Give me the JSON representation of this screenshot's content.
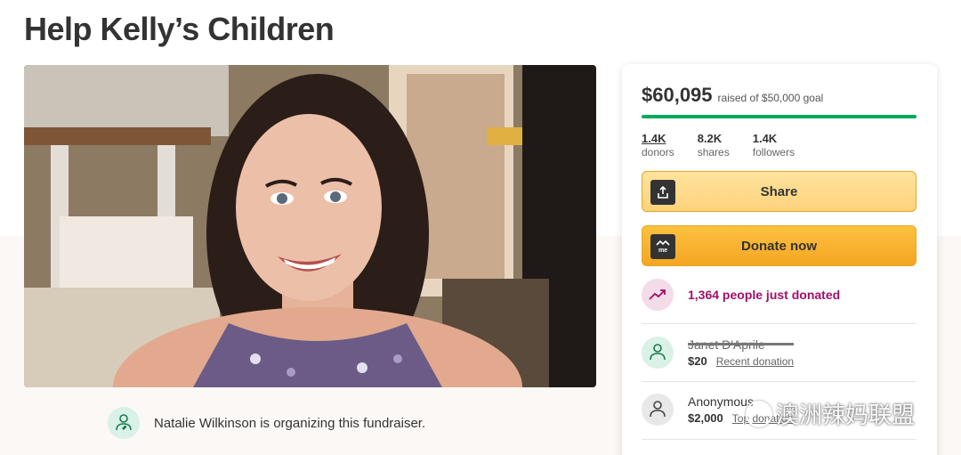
{
  "page": {
    "title": "Help Kelly’s Children"
  },
  "organizer": {
    "text": "Natalie Wilkinson is organizing this fundraiser."
  },
  "donation_card": {
    "amount_raised": "$60,095",
    "goal_text": "raised of $50,000 goal",
    "progress_fraction": 1.0,
    "stats": [
      {
        "value": "1.4K",
        "label": "donors"
      },
      {
        "value": "8.2K",
        "label": "shares"
      },
      {
        "value": "1.4K",
        "label": "followers"
      }
    ],
    "share_label": "Share",
    "donate_label": "Donate now",
    "trend_text": "1,364 people just donated",
    "donations": [
      {
        "name": "Janet D'Aprile",
        "amount": "$20",
        "tag": "Recent donation"
      },
      {
        "name": "Anonymous",
        "amount": "$2,000",
        "tag": "Top donation"
      }
    ]
  },
  "watermark": {
    "text": "澳洲辣妈联盟"
  },
  "colors": {
    "progress": "#02a95c",
    "share_button": "#fdd27c",
    "donate_button": "#f5a623",
    "trend": "#a01069"
  }
}
